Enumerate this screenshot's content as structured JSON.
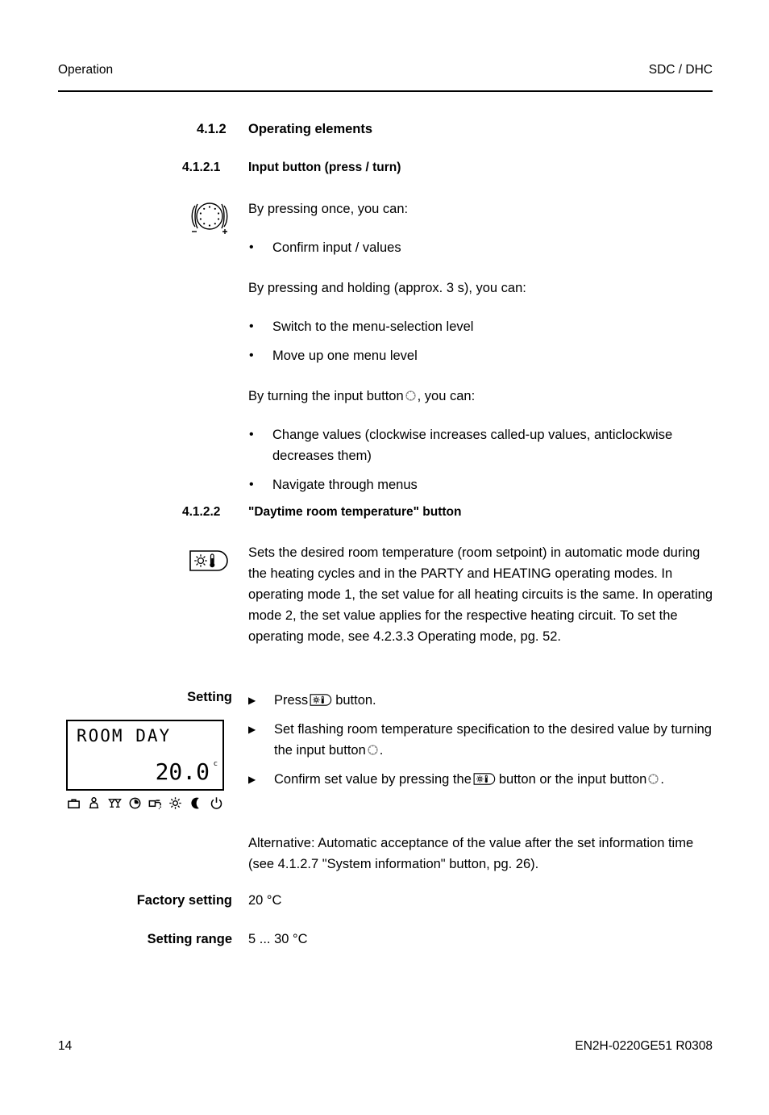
{
  "header": {
    "left": "Operation",
    "right": "SDC / DHC"
  },
  "sections": {
    "s412": {
      "number": "4.1.2",
      "title": "Operating elements"
    },
    "s4121": {
      "number": "4.1.2.1",
      "title": "Input button (press / turn)"
    },
    "s4122": {
      "number": "4.1.2.2",
      "title": "\"Daytime room temperature\" button"
    }
  },
  "input_button": {
    "press_once_intro": "By pressing once, you can:",
    "press_once_items": [
      "Confirm input / values"
    ],
    "press_hold_intro": "By pressing and holding (approx. 3 s), you can:",
    "press_hold_items": [
      "Switch to the menu-selection level",
      "Move up one menu level"
    ],
    "turn_intro_before": "By turning the input button",
    "turn_intro_after": ", you can:",
    "turn_items": [
      "Change values (clockwise increases called-up values, anticlockwise decreases them)",
      "Navigate through menus"
    ]
  },
  "daytime": {
    "description": "Sets the desired room temperature (room setpoint) in automatic mode during the heating cycles and in the PARTY and HEATING operating modes. In operating mode 1, the set value for all heating circuits is the same. In operating mode 2, the set value applies for the respective heating circuit. To set the operating mode, see 4.2.3.3 Operating mode, pg. 52.",
    "setting_label": "Setting",
    "steps": [
      {
        "before": "Press",
        "icon": "day-button-icon",
        "after": "button."
      },
      {
        "before": "Set flashing room temperature specification to the desired value by turning the input button",
        "icon": "knob-icon",
        "after": "."
      },
      {
        "before": "Confirm set value by pressing the",
        "icon": "day-button-icon",
        "middle": "button or the input button",
        "icon2": "knob-icon",
        "after": "."
      }
    ],
    "alternative": "Alternative: Automatic acceptance of the value after the set information time (see 4.1.2.7 \"System information\" button, pg. 26).",
    "factory_setting_label": "Factory setting",
    "factory_setting_value": "20 °C",
    "setting_range_label": "Setting range",
    "setting_range_value": "5 ... 30 °C"
  },
  "lcd": {
    "line1": "ROOM DAY",
    "value": "20.0",
    "degree": "c",
    "status_icons": [
      "suitcase-icon",
      "person-seated-icon",
      "cocktail-glasses-icon",
      "clock-icon",
      "faucet-icon",
      "sun-icon",
      "moon-icon",
      "power-icon"
    ]
  },
  "footer": {
    "page_number": "14",
    "document_code": "EN2H-0220GE51 R0308"
  }
}
